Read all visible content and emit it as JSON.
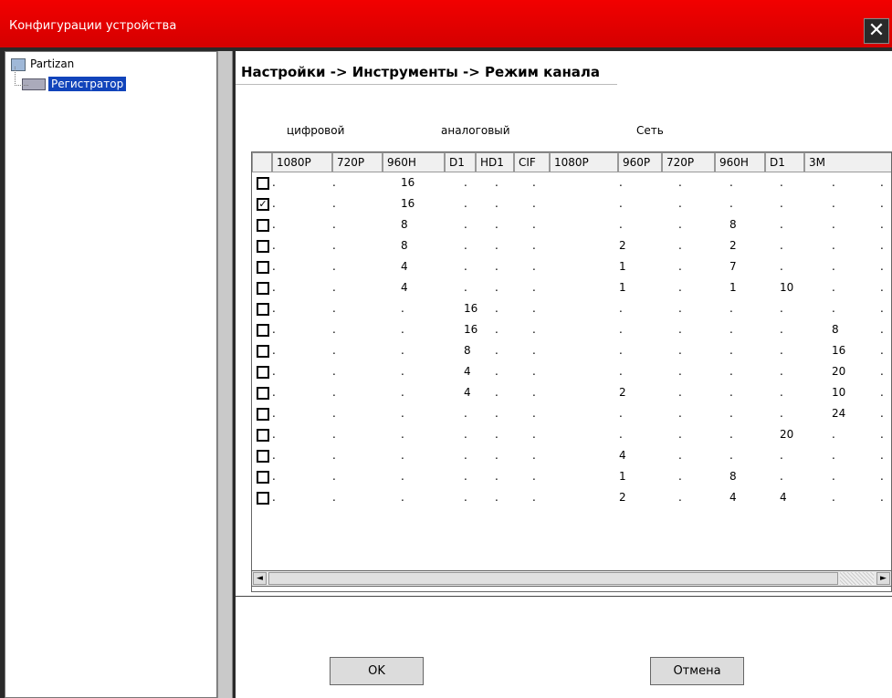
{
  "window": {
    "title": "Конфигурации устройства",
    "close_label": "✕"
  },
  "tree": {
    "root": "Partizan",
    "child": "Регистратор"
  },
  "main": {
    "heading": "Настройки -> Инструменты -> Режим канала",
    "groups": {
      "digital": "цифровой",
      "analog": "аналоговый",
      "network": "Сеть"
    },
    "columns": [
      "1080P",
      "720P",
      "960H",
      "D1",
      "HD1",
      "CIF",
      "1080P",
      "960P",
      "720P",
      "960H",
      "D1",
      "3M"
    ],
    "rows": [
      {
        "checked": false,
        "values": [
          ".",
          ".",
          "16",
          ".",
          ".",
          ".",
          ".",
          ".",
          ".",
          ".",
          ".",
          "."
        ]
      },
      {
        "checked": true,
        "values": [
          ".",
          ".",
          "16",
          ".",
          ".",
          ".",
          ".",
          ".",
          ".",
          ".",
          ".",
          "."
        ]
      },
      {
        "checked": false,
        "values": [
          ".",
          ".",
          "8",
          ".",
          ".",
          ".",
          ".",
          ".",
          "8",
          ".",
          ".",
          "."
        ]
      },
      {
        "checked": false,
        "values": [
          ".",
          ".",
          "8",
          ".",
          ".",
          ".",
          "2",
          ".",
          "2",
          ".",
          ".",
          "."
        ]
      },
      {
        "checked": false,
        "values": [
          ".",
          ".",
          "4",
          ".",
          ".",
          ".",
          "1",
          ".",
          "7",
          ".",
          ".",
          "."
        ]
      },
      {
        "checked": false,
        "values": [
          ".",
          ".",
          "4",
          ".",
          ".",
          ".",
          "1",
          ".",
          "1",
          "10",
          ".",
          "."
        ]
      },
      {
        "checked": false,
        "values": [
          ".",
          ".",
          ".",
          "16",
          ".",
          ".",
          ".",
          ".",
          ".",
          ".",
          ".",
          "."
        ]
      },
      {
        "checked": false,
        "values": [
          ".",
          ".",
          ".",
          "16",
          ".",
          ".",
          ".",
          ".",
          ".",
          ".",
          "8",
          "."
        ]
      },
      {
        "checked": false,
        "values": [
          ".",
          ".",
          ".",
          "8",
          ".",
          ".",
          ".",
          ".",
          ".",
          ".",
          "16",
          "."
        ]
      },
      {
        "checked": false,
        "values": [
          ".",
          ".",
          ".",
          "4",
          ".",
          ".",
          ".",
          ".",
          ".",
          ".",
          "20",
          "."
        ]
      },
      {
        "checked": false,
        "values": [
          ".",
          ".",
          ".",
          "4",
          ".",
          ".",
          "2",
          ".",
          ".",
          ".",
          "10",
          "."
        ]
      },
      {
        "checked": false,
        "values": [
          ".",
          ".",
          ".",
          ".",
          ".",
          ".",
          ".",
          ".",
          ".",
          ".",
          "24",
          "."
        ]
      },
      {
        "checked": false,
        "values": [
          ".",
          ".",
          ".",
          ".",
          ".",
          ".",
          ".",
          ".",
          ".",
          "20",
          ".",
          "."
        ]
      },
      {
        "checked": false,
        "values": [
          ".",
          ".",
          ".",
          ".",
          ".",
          ".",
          "4",
          ".",
          ".",
          ".",
          ".",
          "."
        ]
      },
      {
        "checked": false,
        "values": [
          ".",
          ".",
          ".",
          ".",
          ".",
          ".",
          "1",
          ".",
          "8",
          ".",
          ".",
          "."
        ]
      },
      {
        "checked": false,
        "values": [
          ".",
          ".",
          ".",
          ".",
          ".",
          ".",
          "2",
          ".",
          "4",
          "4",
          ".",
          "."
        ]
      }
    ],
    "scroll_left": "◄",
    "scroll_right": "►",
    "ok_label": "OK",
    "cancel_label": "Отмена"
  }
}
